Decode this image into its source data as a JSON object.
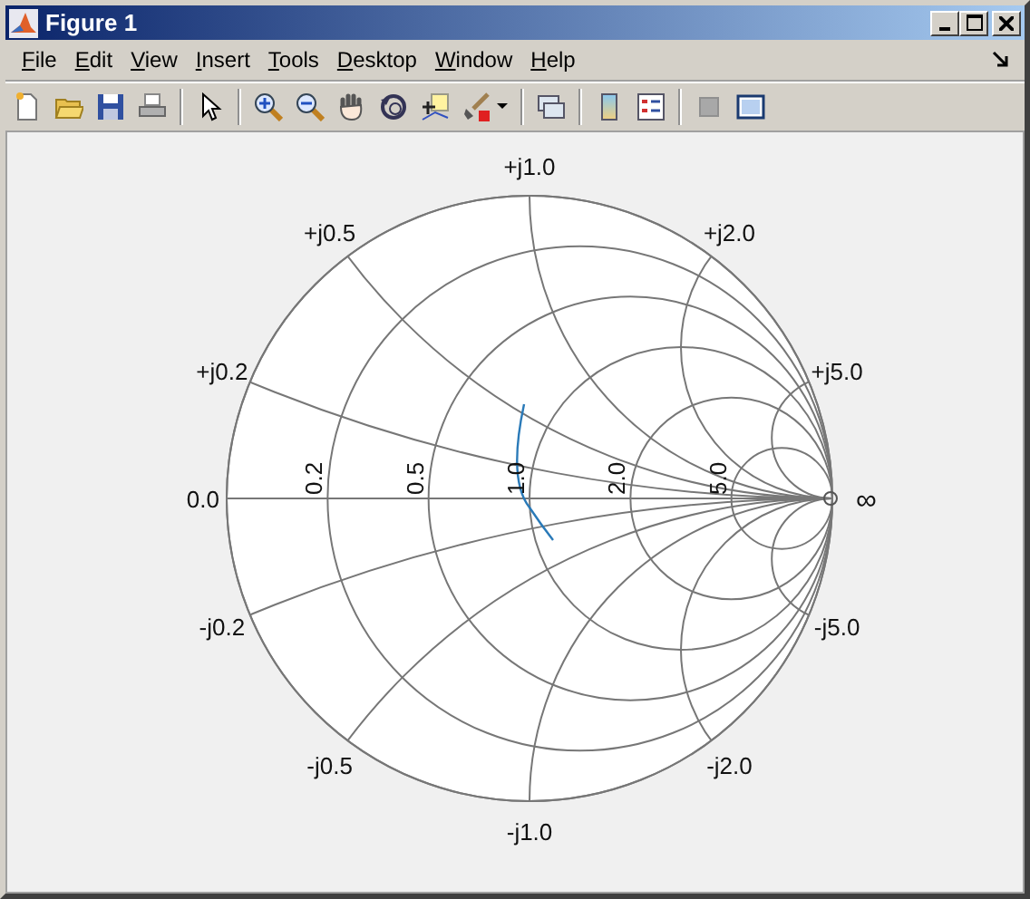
{
  "window": {
    "title": "Figure 1"
  },
  "menu": [
    {
      "label": "File"
    },
    {
      "label": "Edit"
    },
    {
      "label": "View"
    },
    {
      "label": "Insert"
    },
    {
      "label": "Tools"
    },
    {
      "label": "Desktop"
    },
    {
      "label": "Window"
    },
    {
      "label": "Help"
    }
  ],
  "smith_chart": {
    "left_label": "0.0",
    "right_label": "∞",
    "resistance_labels": [
      "0.2",
      "0.5",
      "1.0",
      "2.0",
      "5.0"
    ],
    "upper_reactance_labels": [
      "+j0.2",
      "+j0.5",
      "+j1.0",
      "+j2.0",
      "+j5.0"
    ],
    "lower_reactance_labels": [
      "-j0.2",
      "-j0.5",
      "-j1.0",
      "-j2.0",
      "-j5.0"
    ]
  }
}
